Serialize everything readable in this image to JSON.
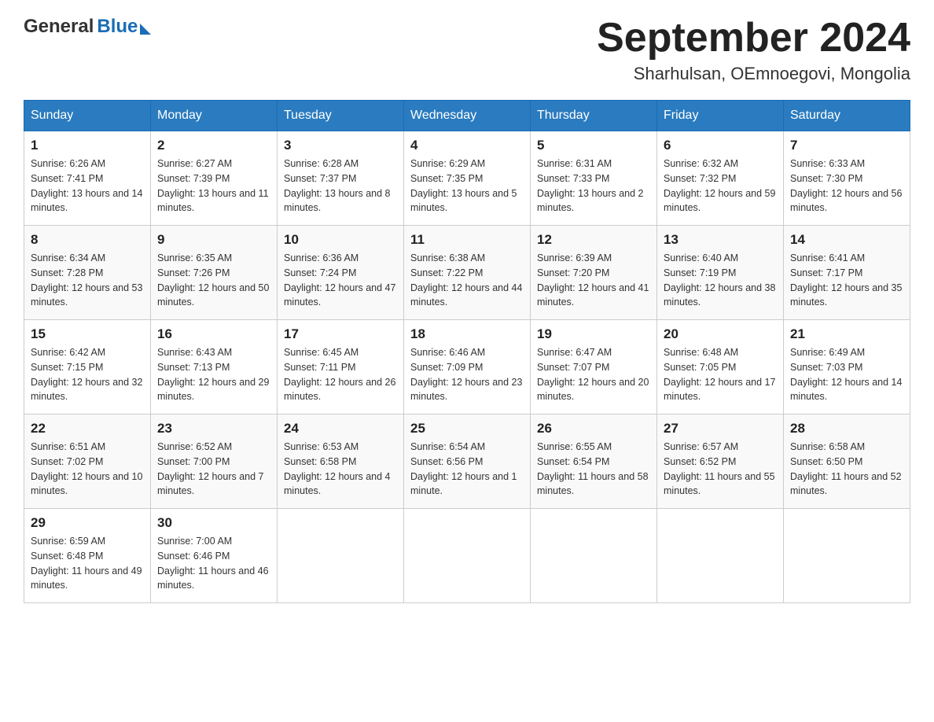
{
  "header": {
    "logo_general": "General",
    "logo_blue": "Blue",
    "title": "September 2024",
    "subtitle": "Sharhulsan, OEmnoegovi, Mongolia"
  },
  "days_of_week": [
    "Sunday",
    "Monday",
    "Tuesday",
    "Wednesday",
    "Thursday",
    "Friday",
    "Saturday"
  ],
  "weeks": [
    [
      {
        "day": "1",
        "sunrise": "Sunrise: 6:26 AM",
        "sunset": "Sunset: 7:41 PM",
        "daylight": "Daylight: 13 hours and 14 minutes."
      },
      {
        "day": "2",
        "sunrise": "Sunrise: 6:27 AM",
        "sunset": "Sunset: 7:39 PM",
        "daylight": "Daylight: 13 hours and 11 minutes."
      },
      {
        "day": "3",
        "sunrise": "Sunrise: 6:28 AM",
        "sunset": "Sunset: 7:37 PM",
        "daylight": "Daylight: 13 hours and 8 minutes."
      },
      {
        "day": "4",
        "sunrise": "Sunrise: 6:29 AM",
        "sunset": "Sunset: 7:35 PM",
        "daylight": "Daylight: 13 hours and 5 minutes."
      },
      {
        "day": "5",
        "sunrise": "Sunrise: 6:31 AM",
        "sunset": "Sunset: 7:33 PM",
        "daylight": "Daylight: 13 hours and 2 minutes."
      },
      {
        "day": "6",
        "sunrise": "Sunrise: 6:32 AM",
        "sunset": "Sunset: 7:32 PM",
        "daylight": "Daylight: 12 hours and 59 minutes."
      },
      {
        "day": "7",
        "sunrise": "Sunrise: 6:33 AM",
        "sunset": "Sunset: 7:30 PM",
        "daylight": "Daylight: 12 hours and 56 minutes."
      }
    ],
    [
      {
        "day": "8",
        "sunrise": "Sunrise: 6:34 AM",
        "sunset": "Sunset: 7:28 PM",
        "daylight": "Daylight: 12 hours and 53 minutes."
      },
      {
        "day": "9",
        "sunrise": "Sunrise: 6:35 AM",
        "sunset": "Sunset: 7:26 PM",
        "daylight": "Daylight: 12 hours and 50 minutes."
      },
      {
        "day": "10",
        "sunrise": "Sunrise: 6:36 AM",
        "sunset": "Sunset: 7:24 PM",
        "daylight": "Daylight: 12 hours and 47 minutes."
      },
      {
        "day": "11",
        "sunrise": "Sunrise: 6:38 AM",
        "sunset": "Sunset: 7:22 PM",
        "daylight": "Daylight: 12 hours and 44 minutes."
      },
      {
        "day": "12",
        "sunrise": "Sunrise: 6:39 AM",
        "sunset": "Sunset: 7:20 PM",
        "daylight": "Daylight: 12 hours and 41 minutes."
      },
      {
        "day": "13",
        "sunrise": "Sunrise: 6:40 AM",
        "sunset": "Sunset: 7:19 PM",
        "daylight": "Daylight: 12 hours and 38 minutes."
      },
      {
        "day": "14",
        "sunrise": "Sunrise: 6:41 AM",
        "sunset": "Sunset: 7:17 PM",
        "daylight": "Daylight: 12 hours and 35 minutes."
      }
    ],
    [
      {
        "day": "15",
        "sunrise": "Sunrise: 6:42 AM",
        "sunset": "Sunset: 7:15 PM",
        "daylight": "Daylight: 12 hours and 32 minutes."
      },
      {
        "day": "16",
        "sunrise": "Sunrise: 6:43 AM",
        "sunset": "Sunset: 7:13 PM",
        "daylight": "Daylight: 12 hours and 29 minutes."
      },
      {
        "day": "17",
        "sunrise": "Sunrise: 6:45 AM",
        "sunset": "Sunset: 7:11 PM",
        "daylight": "Daylight: 12 hours and 26 minutes."
      },
      {
        "day": "18",
        "sunrise": "Sunrise: 6:46 AM",
        "sunset": "Sunset: 7:09 PM",
        "daylight": "Daylight: 12 hours and 23 minutes."
      },
      {
        "day": "19",
        "sunrise": "Sunrise: 6:47 AM",
        "sunset": "Sunset: 7:07 PM",
        "daylight": "Daylight: 12 hours and 20 minutes."
      },
      {
        "day": "20",
        "sunrise": "Sunrise: 6:48 AM",
        "sunset": "Sunset: 7:05 PM",
        "daylight": "Daylight: 12 hours and 17 minutes."
      },
      {
        "day": "21",
        "sunrise": "Sunrise: 6:49 AM",
        "sunset": "Sunset: 7:03 PM",
        "daylight": "Daylight: 12 hours and 14 minutes."
      }
    ],
    [
      {
        "day": "22",
        "sunrise": "Sunrise: 6:51 AM",
        "sunset": "Sunset: 7:02 PM",
        "daylight": "Daylight: 12 hours and 10 minutes."
      },
      {
        "day": "23",
        "sunrise": "Sunrise: 6:52 AM",
        "sunset": "Sunset: 7:00 PM",
        "daylight": "Daylight: 12 hours and 7 minutes."
      },
      {
        "day": "24",
        "sunrise": "Sunrise: 6:53 AM",
        "sunset": "Sunset: 6:58 PM",
        "daylight": "Daylight: 12 hours and 4 minutes."
      },
      {
        "day": "25",
        "sunrise": "Sunrise: 6:54 AM",
        "sunset": "Sunset: 6:56 PM",
        "daylight": "Daylight: 12 hours and 1 minute."
      },
      {
        "day": "26",
        "sunrise": "Sunrise: 6:55 AM",
        "sunset": "Sunset: 6:54 PM",
        "daylight": "Daylight: 11 hours and 58 minutes."
      },
      {
        "day": "27",
        "sunrise": "Sunrise: 6:57 AM",
        "sunset": "Sunset: 6:52 PM",
        "daylight": "Daylight: 11 hours and 55 minutes."
      },
      {
        "day": "28",
        "sunrise": "Sunrise: 6:58 AM",
        "sunset": "Sunset: 6:50 PM",
        "daylight": "Daylight: 11 hours and 52 minutes."
      }
    ],
    [
      {
        "day": "29",
        "sunrise": "Sunrise: 6:59 AM",
        "sunset": "Sunset: 6:48 PM",
        "daylight": "Daylight: 11 hours and 49 minutes."
      },
      {
        "day": "30",
        "sunrise": "Sunrise: 7:00 AM",
        "sunset": "Sunset: 6:46 PM",
        "daylight": "Daylight: 11 hours and 46 minutes."
      },
      null,
      null,
      null,
      null,
      null
    ]
  ]
}
